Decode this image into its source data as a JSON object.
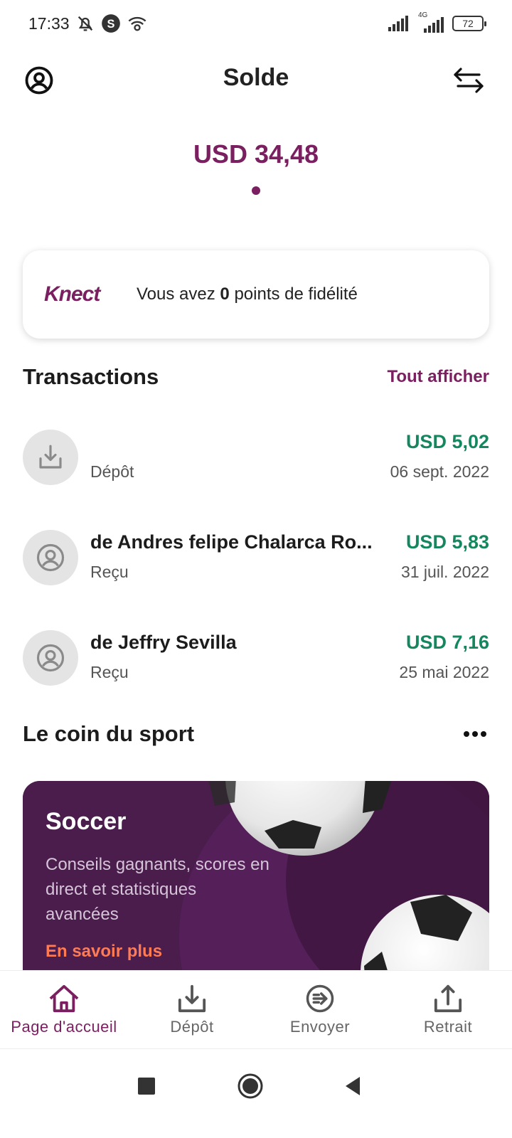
{
  "status_bar": {
    "time": "17:33",
    "battery": "72",
    "network": "4G"
  },
  "header": {
    "title": "Solde"
  },
  "balance": {
    "amount": "USD 34,48"
  },
  "loyalty": {
    "brand": "Knect",
    "text_before": "Vous avez ",
    "points": "0",
    "text_after": " points de fidélité"
  },
  "transactions": {
    "title": "Transactions",
    "view_all": "Tout afficher",
    "items": [
      {
        "name": "",
        "type": "Dépôt",
        "amount": "USD 5,02",
        "date": "06 sept. 2022",
        "icon": "deposit-icon"
      },
      {
        "name": "de Andres felipe Chalarca Ro...",
        "type": "Reçu",
        "amount": "USD 5,83",
        "date": "31 juil. 2022",
        "icon": "user-icon"
      },
      {
        "name": "de Jeffry Sevilla",
        "type": "Reçu",
        "amount": "USD 7,16",
        "date": "25 mai 2022",
        "icon": "user-icon"
      }
    ]
  },
  "sport": {
    "title": "Le coin du sport",
    "card_title": "Soccer",
    "card_desc": "Conseils gagnants, scores en direct et statistiques avancées",
    "card_link": "En savoir plus"
  },
  "bottom_nav": {
    "items": [
      {
        "label": "Page d'accueil",
        "icon": "home-icon",
        "active": true
      },
      {
        "label": "Dépôt",
        "icon": "deposit-icon",
        "active": false
      },
      {
        "label": "Envoyer",
        "icon": "send-icon",
        "active": false
      },
      {
        "label": "Retrait",
        "icon": "withdraw-icon",
        "active": false
      }
    ]
  },
  "colors": {
    "brand": "#7a1f5f",
    "positive": "#15875f",
    "accent_link": "#ff7b54",
    "card_bg": "#4a1d4d"
  }
}
